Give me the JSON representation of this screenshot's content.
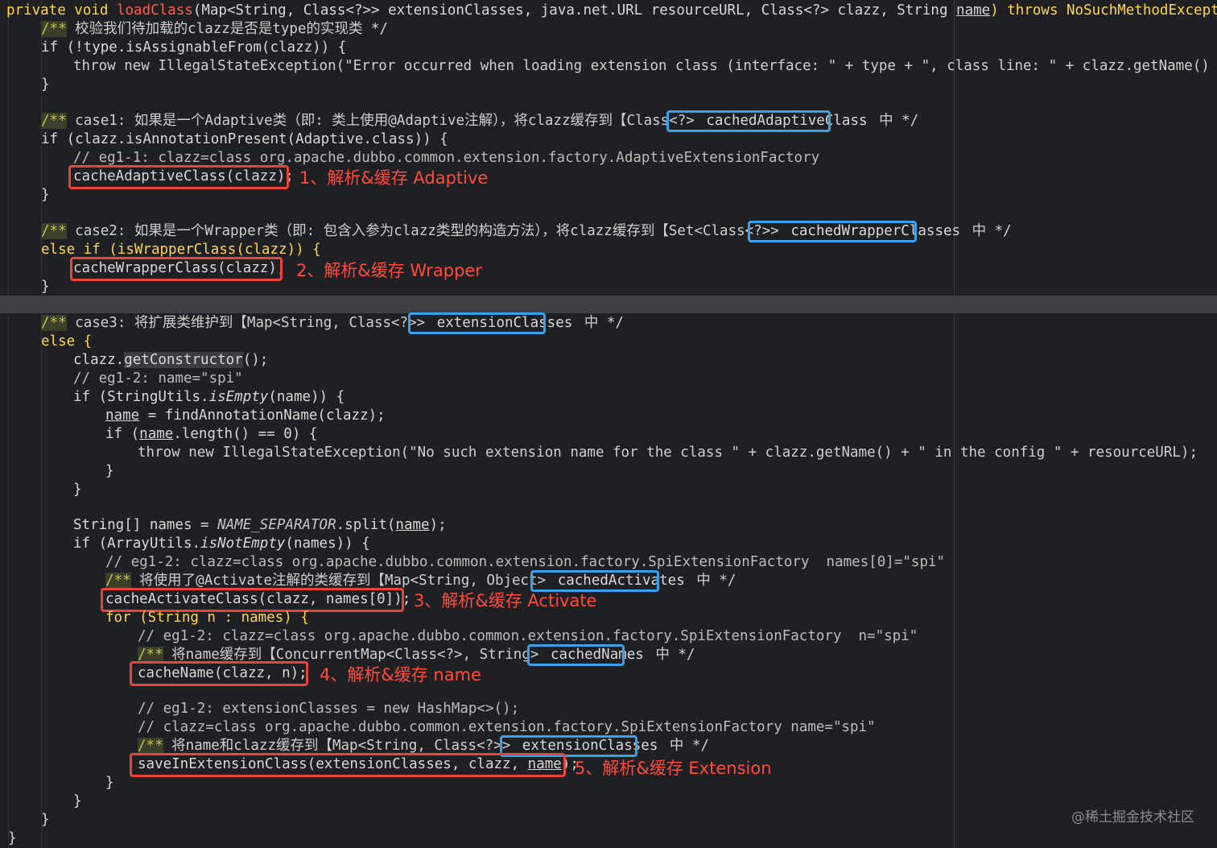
{
  "colors": {
    "background": "#1f2023",
    "keyword": "#ffd54a",
    "method_decl": "#ff5a4a",
    "annotation_red": "#e8443a",
    "annotation_blue": "#3aa0ea"
  },
  "code": {
    "l1_a": "private void ",
    "l1_method": "loadClass",
    "l1_b": "(Map<String, Class<?>> extensionClasses, java.net.URL resourceURL, Class<?> clazz, String ",
    "l1_name": "name",
    "l1_c": ") throws NoSuchMethodException {",
    "l2": "校验我们待加载的clazz是否是type的实现类 */",
    "l3": "if (!type.isAssignableFrom(clazz)) {",
    "l4": "throw new IllegalStateException(\"Error occurred when loading extension class (interface: \" + type + \", class line: \" + clazz.getName() + \"),",
    "close1": "}",
    "l6": "case1: 如果是一个Adaptive类（即: 类上使用@Adaptive注解），将clazz缓存到【Class<?> ",
    "l6_box": "cachedAdaptiveClass",
    "l6_end": " 中 */",
    "l7": "if (clazz.isAnnotationPresent(Adaptive.class)) {",
    "l8": "// eg1-1: clazz=class org.apache.dubbo.common.extension.factory.AdaptiveExtensionFactory",
    "l9": "cacheAdaptiveClass(clazz);",
    "l12": "case2: 如果是一个Wrapper类（即: 包含入参为clazz类型的构造方法），将clazz缓存到【Set<Class<?>> ",
    "l12_box": "cachedWrapperClasses",
    "l12_end": " 中 */",
    "l13": "else if (isWrapperClass(clazz)) {",
    "l14": "cacheWrapperClass(clazz);",
    "l17": "case3: 将扩展类维护到【Map<String, Class<?>> ",
    "l17_box": "extensionClasses",
    "l17_end": " 中 */",
    "l18": "else {",
    "l19_a": "clazz.",
    "l19_b": "getConstructor",
    "l19_c": "();",
    "l20": "// eg1-2: name=\"spi\"",
    "l21_a": "if (StringUtils.",
    "l21_b": "isEmpty",
    "l21_c": "(name)) {",
    "l22_a": "name",
    "l22_b": " = findAnnotationName(clazz);",
    "l23_a": "if (",
    "l23_b": "name",
    "l23_c": ".length() == 0) {",
    "l24": "throw new IllegalStateException(\"No such extension name for the class \" + clazz.getName() + \" in the config \" + resourceURL);",
    "l28_a": "String[] names = ",
    "l28_b": "NAME_SEPARATOR",
    "l28_c": ".split(",
    "l28_d": "name",
    "l28_e": ");",
    "l29_a": "if (ArrayUtils.",
    "l29_b": "isNotEmpty",
    "l29_c": "(names)) {",
    "l30": "// eg1-2: clazz=class org.apache.dubbo.common.extension.factory.SpiExtensionFactory  names[0]=\"spi\"",
    "l31": "将使用了@Activate注解的类缓存到【Map<String, Object> ",
    "l31_box": "cachedActivates",
    "l31_end": " 中 */",
    "l32": "cacheActivateClass(clazz, names[0]);",
    "l33": "for (String n : names) {",
    "l34": "// eg1-2: clazz=class org.apache.dubbo.common.extension.factory.SpiExtensionFactory  n=\"spi\"",
    "l35": "将name缓存到【ConcurrentMap<Class<?>, String> ",
    "l35_box": "cachedNames",
    "l35_end": " 中 */",
    "l36": "cacheName(clazz, n);",
    "l38": "// eg1-2: extensionClasses = new HashMap<>();",
    "l39": "// clazz=class org.apache.dubbo.common.extension.factory.SpiExtensionFactory name=\"spi\"",
    "l40": "将name和clazz缓存到【Map<String, Class<?>> ",
    "l40_box": "extensionClasses",
    "l40_end": " 中 */",
    "l41_a": "saveInExtensionClass(extensionClasses, clazz, ",
    "l41_b": "name",
    "l41_c": ");",
    "doc_open": "/**"
  },
  "annotations": {
    "a1": "1、解析&缓存 Adaptive",
    "a2": "2、解析&缓存 Wrapper",
    "a3": "3、解析&缓存 Activate",
    "a4": "4、解析&缓存 name",
    "a5": "5、解析&缓存 Extension"
  },
  "watermark": "@稀土掘金技术社区"
}
